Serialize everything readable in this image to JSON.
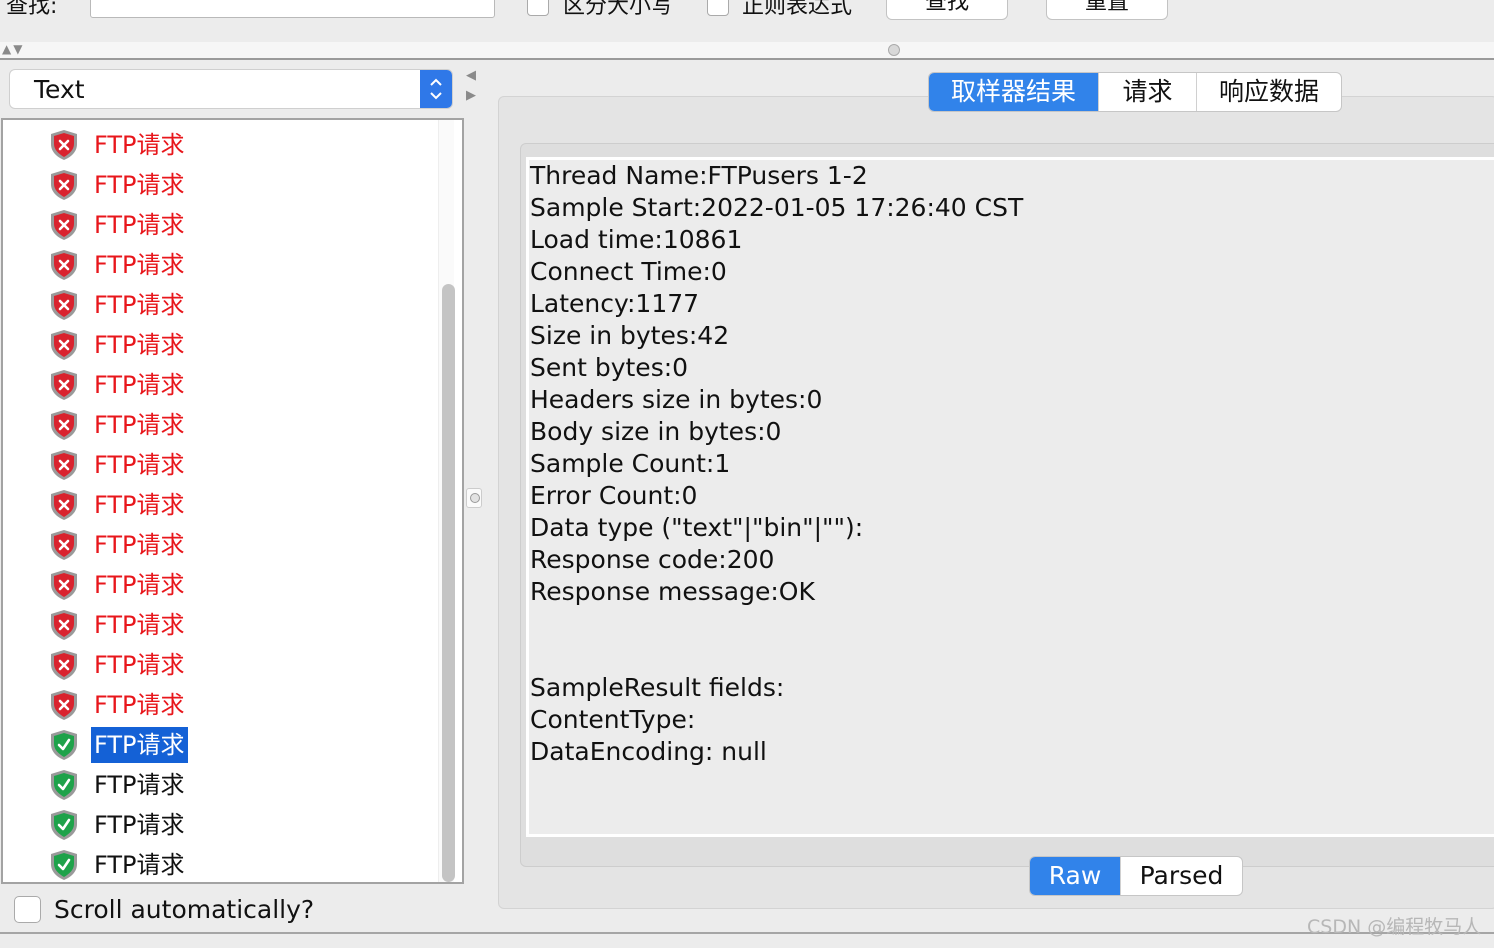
{
  "search": {
    "label": "查找:",
    "value": "",
    "case_label": "区分大小写",
    "regex_label": "正则表达式",
    "find_button": "查找",
    "reset_button": "重置"
  },
  "renderer": {
    "selected": "Text"
  },
  "tree": {
    "items": [
      {
        "label": "FTP请求",
        "status": "error"
      },
      {
        "label": "FTP请求",
        "status": "error"
      },
      {
        "label": "FTP请求",
        "status": "error"
      },
      {
        "label": "FTP请求",
        "status": "error"
      },
      {
        "label": "FTP请求",
        "status": "error"
      },
      {
        "label": "FTP请求",
        "status": "error"
      },
      {
        "label": "FTP请求",
        "status": "error"
      },
      {
        "label": "FTP请求",
        "status": "error"
      },
      {
        "label": "FTP请求",
        "status": "error"
      },
      {
        "label": "FTP请求",
        "status": "error"
      },
      {
        "label": "FTP请求",
        "status": "error"
      },
      {
        "label": "FTP请求",
        "status": "error"
      },
      {
        "label": "FTP请求",
        "status": "error"
      },
      {
        "label": "FTP请求",
        "status": "error"
      },
      {
        "label": "FTP请求",
        "status": "error"
      },
      {
        "label": "FTP请求",
        "status": "success",
        "selected": true
      },
      {
        "label": "FTP请求",
        "status": "success"
      },
      {
        "label": "FTP请求",
        "status": "success"
      },
      {
        "label": "FTP请求",
        "status": "success"
      }
    ],
    "icons": {
      "error": "error-shield-icon",
      "success": "success-shield-icon"
    },
    "colors": {
      "error_text": "#e8161b",
      "error_icon": "#d9232e",
      "success_icon": "#1ea24a",
      "selection": "#1461d6"
    }
  },
  "scroll_auto": {
    "label": "Scroll automatically?",
    "checked": false
  },
  "tabs": [
    {
      "label": "取样器结果",
      "active": true
    },
    {
      "label": "请求",
      "active": false
    },
    {
      "label": "响应数据",
      "active": false
    }
  ],
  "result": {
    "thread_name": "Thread Name:FTPusers 1-2",
    "sample_start": "Sample Start:2022-01-05 17:26:40 CST",
    "load_time": "Load time:10861",
    "connect_time": "Connect Time:0",
    "latency": "Latency:1177",
    "size_bytes": "Size in bytes:42",
    "sent_bytes": "Sent bytes:0",
    "headers_size": "Headers size in bytes:0",
    "body_size": "Body size in bytes:0",
    "sample_count": "Sample Count:1",
    "error_count": "Error Count:0",
    "data_type": "Data type (\"text\"|\"bin\"|\"\"):",
    "response_code": "Response code:200",
    "response_message": "Response message:OK",
    "fields_header": "SampleResult fields:",
    "content_type": "ContentType:",
    "data_encoding": "DataEncoding: null"
  },
  "view_toggle": {
    "raw": "Raw",
    "parsed": "Parsed",
    "active": "raw"
  },
  "accent_color": "#3183ea",
  "watermark": "CSDN @编程牧马人"
}
